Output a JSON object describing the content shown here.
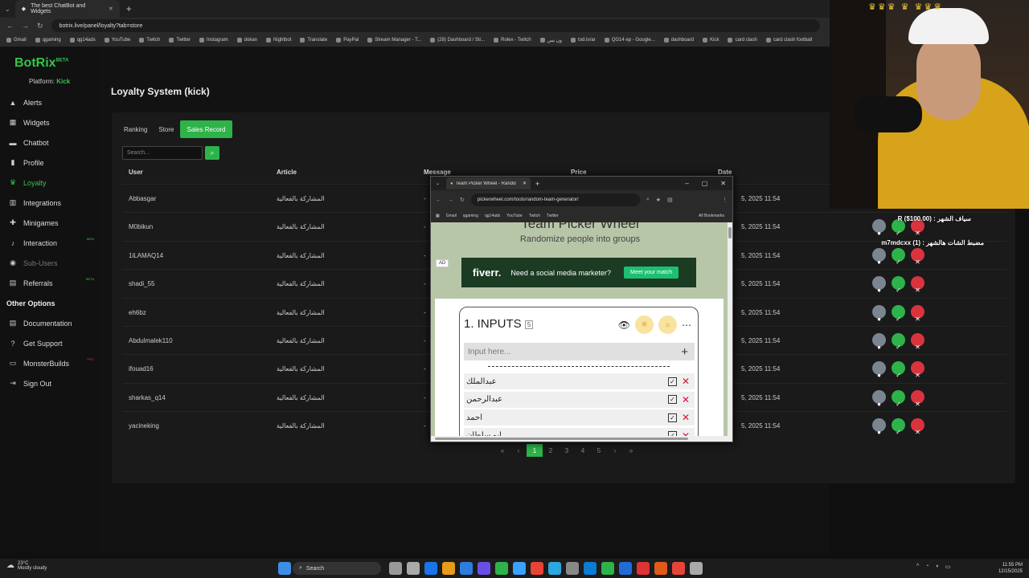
{
  "browser": {
    "tab_title": "The best ChatBot and Widgets",
    "url": "botrix.live/panel/loyalty?tab=store",
    "bookmarks": [
      "Gmail",
      "qgaming",
      "qg14ads",
      "YouTube",
      "Twitch",
      "Twitter",
      "Instagram",
      "dokan",
      "Nightbot",
      "Translate",
      "PayPal",
      "Stream Manager - T...",
      "(28) Dashboard / Str...",
      "Rolex - Twitch",
      "ون يس",
      "tod.tv/ar",
      "QG14 ep - Google...",
      "dashboard",
      "Kick",
      "card clash",
      "card clash football"
    ]
  },
  "app": {
    "logo": "BotRix",
    "logo_badge": "BETA",
    "platform_label": "Platform:",
    "platform_value": "Kick"
  },
  "sidebar": {
    "items": [
      {
        "label": "Alerts",
        "icon": "warning-icon"
      },
      {
        "label": "Widgets",
        "icon": "widgets-icon"
      },
      {
        "label": "Chatbot",
        "icon": "chat-icon"
      },
      {
        "label": "Profile",
        "icon": "profile-icon"
      },
      {
        "label": "Loyalty",
        "icon": "trophy-icon",
        "active": true
      },
      {
        "label": "Integrations",
        "icon": "grid-icon"
      },
      {
        "label": "Minigames",
        "icon": "gamepad-icon"
      },
      {
        "label": "Interaction",
        "icon": "music-icon",
        "badge": "NEW"
      },
      {
        "label": "Sub-Users",
        "icon": "users-icon",
        "dim": true
      },
      {
        "label": "Referrals",
        "icon": "referrals-icon",
        "badge": "BETA"
      }
    ],
    "other_title": "Other Options",
    "other": [
      {
        "label": "Documentation",
        "icon": "doc-icon"
      },
      {
        "label": "Get Support",
        "icon": "help-icon"
      },
      {
        "label": "MonsterBuilds",
        "icon": "monitor-icon",
        "badge": "PRO"
      },
      {
        "label": "Sign Out",
        "icon": "signout-icon"
      }
    ]
  },
  "page": {
    "title": "Loyalty System (kick)",
    "tabs": [
      "Ranking",
      "Store",
      "Sales Record"
    ],
    "active_tab": "Sales Record",
    "search_placeholder": "Search...",
    "columns": [
      "User",
      "Article",
      "Message",
      "Price",
      "Date"
    ],
    "rows": [
      {
        "user": "Abbasgar",
        "article": "المشاركة بالفعالية",
        "date": "5, 2025 11:54"
      },
      {
        "user": "M0bikun",
        "article": "المشاركة بالفعالية",
        "date": "5, 2025 11:54"
      },
      {
        "user": "1iLAMAQ14",
        "article": "المشاركة بالفعالية",
        "date": "5, 2025 11:54"
      },
      {
        "user": "shadi_55",
        "article": "المشاركة بالفعالية",
        "date": "5, 2025 11:54"
      },
      {
        "user": "eh6bz",
        "article": "المشاركة بالفعالية",
        "date": "5, 2025 11:54"
      },
      {
        "user": "Abdulmalek110",
        "article": "المشاركة بالفعالية",
        "date": "5, 2025 11:54"
      },
      {
        "user": "ifouad16",
        "article": "المشاركة بالفعالية",
        "date": "5, 2025 11:54"
      },
      {
        "user": "sharkas_q14",
        "article": "المشاركة بالفعالية",
        "date": "5, 2025 11:54"
      },
      {
        "user": "yacineking",
        "article": "المشاركة بالفعالية",
        "date": "5, 2025 11:54"
      }
    ],
    "pages": [
      "1",
      "2",
      "3",
      "4",
      "5"
    ],
    "current_page": "1"
  },
  "overlay": {
    "line1": "سياف الشهر : R ($100.00)",
    "line2": "مضبط الشات هالشهر : m7mdcxx (1)"
  },
  "popup": {
    "tab_title": "Team Picker Wheel - Randomiz",
    "url": "pickerwheel.com/tools/random-team-generator/",
    "bookmarks": [
      "Gmail",
      "qgaming",
      "qg14ads",
      "YouTube",
      "Twitch",
      "Twitter"
    ],
    "all_bookmarks": "All Bookmarks",
    "site_title": "Team Picker Wheel",
    "site_subtitle": "Randomize people into groups",
    "ad_tag": "AD",
    "ad_brand": "fiverr.",
    "ad_text": "Need a social media marketer?",
    "ad_cta": "Meet your match",
    "inputs_title": "1. INPUTS",
    "inputs_count": "5",
    "input_placeholder": "Input here...",
    "entries": [
      "عبدالملك",
      "عبدالرحمن",
      "احمد",
      "ابو سلطان"
    ]
  },
  "taskbar": {
    "temp": "23°C",
    "weather": "Mostly cloudy",
    "search": "Search",
    "time": "11:55 PM",
    "date": "12/15/2025"
  }
}
